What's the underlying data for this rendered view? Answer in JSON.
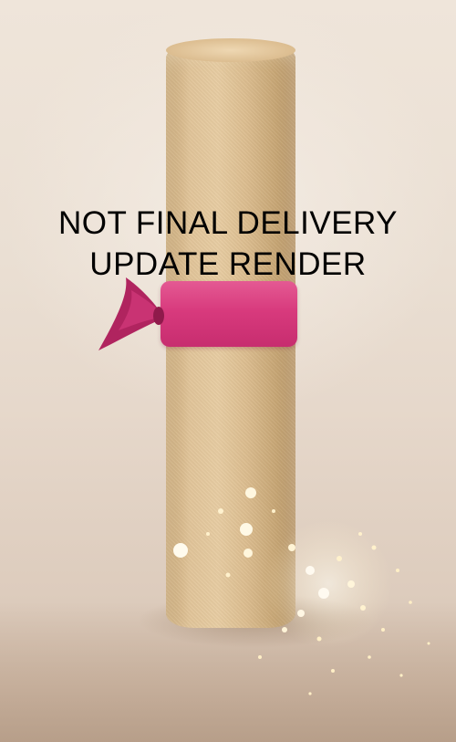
{
  "overlay": {
    "line1": "NOT FINAL DELIVERY",
    "line2": "UPDATE RENDER"
  },
  "colors": {
    "background": "#eadfd3",
    "scroll": "#e2c59a",
    "ribbon": "#d83a7d",
    "text": "#000000"
  },
  "image_subject": "rolled-scroll-with-pink-ribbon"
}
